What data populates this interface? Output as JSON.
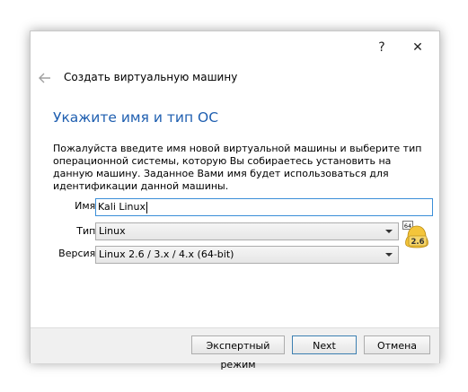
{
  "titlebar": {
    "help_label": "?",
    "close_label": "✕"
  },
  "header": {
    "title": "Создать виртуальную машину"
  },
  "main": {
    "heading": "Укажите имя и тип ОС",
    "description": "Пожалуйста введите имя новой виртуальной машины и выберите тип операционной системы, которую Вы собираетесь установить на данную машину. Заданное Вами имя будет использоваться для идентификации данной машины."
  },
  "form": {
    "name_label": "Имя:",
    "name_value": "Kali Linux",
    "type_label": "Тип:",
    "type_value": "Linux",
    "version_label": "Версия:",
    "version_value": "Linux 2.6 / 3.x / 4.x (64-bit)",
    "os_icon": {
      "name": "linux-64-icon",
      "badge_top": "64",
      "badge_version": "2.6"
    }
  },
  "footer": {
    "expert_label": "Экспертный режим",
    "next_label": "Next",
    "cancel_label": "Отмена"
  },
  "colors": {
    "heading": "#1f5fb0",
    "input_focus": "#3b8ed8",
    "footer_bg": "#f0f0f0"
  }
}
